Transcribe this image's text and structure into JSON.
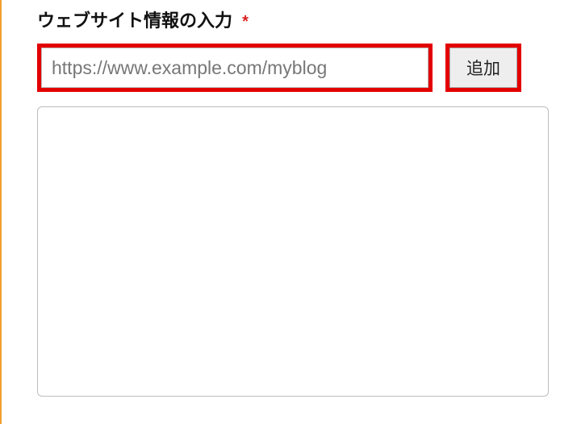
{
  "form": {
    "section_label": "ウェブサイト情報の入力",
    "required_mark": "*",
    "url_input": {
      "placeholder": "https://www.example.com/myblog",
      "value": ""
    },
    "add_button_label": "追加",
    "list": {
      "items": []
    }
  },
  "colors": {
    "highlight_border": "#e30000",
    "accent_bar": "#f0a030"
  }
}
